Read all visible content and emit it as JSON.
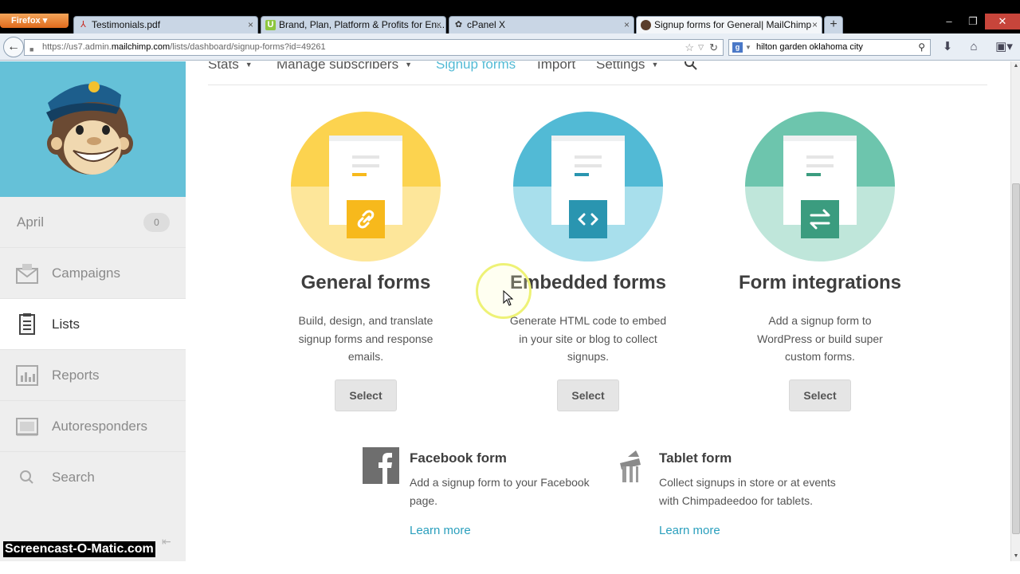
{
  "browser": {
    "app_button": "Firefox",
    "tabs": [
      {
        "title": "Testimonials.pdf",
        "favicon": "pdf-icon"
      },
      {
        "title": "Brand, Plan, Platform & Profits for En...",
        "favicon": "u-icon"
      },
      {
        "title": "cPanel X",
        "favicon": "cpanel-icon"
      },
      {
        "title": "Signup forms for General| MailChimp",
        "favicon": "mailchimp-icon"
      }
    ],
    "url_prefix": "https://us7.admin.",
    "url_domain": "mailchimp.com",
    "url_suffix": "/lists/dashboard/signup-forms?id=49261",
    "search_value": "hilton garden oklahoma city"
  },
  "sidebar": {
    "account_name": "April",
    "account_count": "0",
    "items": [
      {
        "label": "Campaigns",
        "icon": "envelope-icon"
      },
      {
        "label": "Lists",
        "icon": "list-icon"
      },
      {
        "label": "Reports",
        "icon": "reports-icon"
      },
      {
        "label": "Autoresponders",
        "icon": "autoresponder-icon"
      },
      {
        "label": "Search",
        "icon": "search-icon"
      }
    ]
  },
  "subnav": {
    "stats": "Stats",
    "manage": "Manage subscribers",
    "signup": "Signup forms",
    "import": "Import",
    "settings": "Settings"
  },
  "cards": [
    {
      "title": "General forms",
      "desc": "Build, design, and translate signup forms and response emails.",
      "button": "Select",
      "color_top": "#fcd34f",
      "color_bottom": "#fde69a",
      "badge_color": "#f7b91c",
      "icon": "link-icon"
    },
    {
      "title": "Embedded forms",
      "desc": "Generate HTML code to embed in your site or blog to collect signups.",
      "button": "Select",
      "color_top": "#52bad5",
      "color_bottom": "#a8dfec",
      "badge_color": "#2a95b0",
      "icon": "code-icon"
    },
    {
      "title": "Form integrations",
      "desc": "Add a signup form to WordPress or build super custom forms.",
      "button": "Select",
      "color_top": "#6dc5ad",
      "color_bottom": "#bfe6da",
      "badge_color": "#3b9c7f",
      "icon": "swap-icon"
    }
  ],
  "extras": [
    {
      "title": "Facebook form",
      "desc": "Add a signup form to your Facebook page.",
      "link": "Learn more",
      "icon": "facebook-icon"
    },
    {
      "title": "Tablet form",
      "desc": "Collect signups in store or at events with Chimpadeedoo for tablets.",
      "link": "Learn more",
      "icon": "chimpadeedoo-icon"
    }
  ],
  "watermark": "Screencast-O-Matic.com"
}
